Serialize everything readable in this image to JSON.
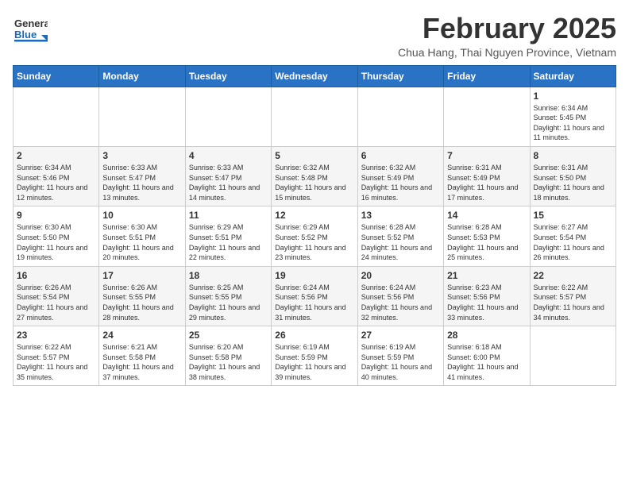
{
  "header": {
    "logo_general": "General",
    "logo_blue": "Blue",
    "title": "February 2025",
    "subtitle": "Chua Hang, Thai Nguyen Province, Vietnam"
  },
  "calendar": {
    "days_of_week": [
      "Sunday",
      "Monday",
      "Tuesday",
      "Wednesday",
      "Thursday",
      "Friday",
      "Saturday"
    ],
    "weeks": [
      [
        {
          "day": "",
          "info": ""
        },
        {
          "day": "",
          "info": ""
        },
        {
          "day": "",
          "info": ""
        },
        {
          "day": "",
          "info": ""
        },
        {
          "day": "",
          "info": ""
        },
        {
          "day": "",
          "info": ""
        },
        {
          "day": "1",
          "info": "Sunrise: 6:34 AM\nSunset: 5:45 PM\nDaylight: 11 hours and 11 minutes."
        }
      ],
      [
        {
          "day": "2",
          "info": "Sunrise: 6:34 AM\nSunset: 5:46 PM\nDaylight: 11 hours and 12 minutes."
        },
        {
          "day": "3",
          "info": "Sunrise: 6:33 AM\nSunset: 5:47 PM\nDaylight: 11 hours and 13 minutes."
        },
        {
          "day": "4",
          "info": "Sunrise: 6:33 AM\nSunset: 5:47 PM\nDaylight: 11 hours and 14 minutes."
        },
        {
          "day": "5",
          "info": "Sunrise: 6:32 AM\nSunset: 5:48 PM\nDaylight: 11 hours and 15 minutes."
        },
        {
          "day": "6",
          "info": "Sunrise: 6:32 AM\nSunset: 5:49 PM\nDaylight: 11 hours and 16 minutes."
        },
        {
          "day": "7",
          "info": "Sunrise: 6:31 AM\nSunset: 5:49 PM\nDaylight: 11 hours and 17 minutes."
        },
        {
          "day": "8",
          "info": "Sunrise: 6:31 AM\nSunset: 5:50 PM\nDaylight: 11 hours and 18 minutes."
        }
      ],
      [
        {
          "day": "9",
          "info": "Sunrise: 6:30 AM\nSunset: 5:50 PM\nDaylight: 11 hours and 19 minutes."
        },
        {
          "day": "10",
          "info": "Sunrise: 6:30 AM\nSunset: 5:51 PM\nDaylight: 11 hours and 20 minutes."
        },
        {
          "day": "11",
          "info": "Sunrise: 6:29 AM\nSunset: 5:51 PM\nDaylight: 11 hours and 22 minutes."
        },
        {
          "day": "12",
          "info": "Sunrise: 6:29 AM\nSunset: 5:52 PM\nDaylight: 11 hours and 23 minutes."
        },
        {
          "day": "13",
          "info": "Sunrise: 6:28 AM\nSunset: 5:52 PM\nDaylight: 11 hours and 24 minutes."
        },
        {
          "day": "14",
          "info": "Sunrise: 6:28 AM\nSunset: 5:53 PM\nDaylight: 11 hours and 25 minutes."
        },
        {
          "day": "15",
          "info": "Sunrise: 6:27 AM\nSunset: 5:54 PM\nDaylight: 11 hours and 26 minutes."
        }
      ],
      [
        {
          "day": "16",
          "info": "Sunrise: 6:26 AM\nSunset: 5:54 PM\nDaylight: 11 hours and 27 minutes."
        },
        {
          "day": "17",
          "info": "Sunrise: 6:26 AM\nSunset: 5:55 PM\nDaylight: 11 hours and 28 minutes."
        },
        {
          "day": "18",
          "info": "Sunrise: 6:25 AM\nSunset: 5:55 PM\nDaylight: 11 hours and 29 minutes."
        },
        {
          "day": "19",
          "info": "Sunrise: 6:24 AM\nSunset: 5:56 PM\nDaylight: 11 hours and 31 minutes."
        },
        {
          "day": "20",
          "info": "Sunrise: 6:24 AM\nSunset: 5:56 PM\nDaylight: 11 hours and 32 minutes."
        },
        {
          "day": "21",
          "info": "Sunrise: 6:23 AM\nSunset: 5:56 PM\nDaylight: 11 hours and 33 minutes."
        },
        {
          "day": "22",
          "info": "Sunrise: 6:22 AM\nSunset: 5:57 PM\nDaylight: 11 hours and 34 minutes."
        }
      ],
      [
        {
          "day": "23",
          "info": "Sunrise: 6:22 AM\nSunset: 5:57 PM\nDaylight: 11 hours and 35 minutes."
        },
        {
          "day": "24",
          "info": "Sunrise: 6:21 AM\nSunset: 5:58 PM\nDaylight: 11 hours and 37 minutes."
        },
        {
          "day": "25",
          "info": "Sunrise: 6:20 AM\nSunset: 5:58 PM\nDaylight: 11 hours and 38 minutes."
        },
        {
          "day": "26",
          "info": "Sunrise: 6:19 AM\nSunset: 5:59 PM\nDaylight: 11 hours and 39 minutes."
        },
        {
          "day": "27",
          "info": "Sunrise: 6:19 AM\nSunset: 5:59 PM\nDaylight: 11 hours and 40 minutes."
        },
        {
          "day": "28",
          "info": "Sunrise: 6:18 AM\nSunset: 6:00 PM\nDaylight: 11 hours and 41 minutes."
        },
        {
          "day": "",
          "info": ""
        }
      ]
    ]
  }
}
